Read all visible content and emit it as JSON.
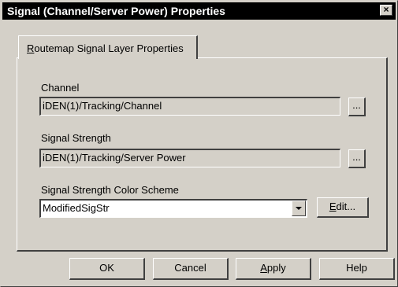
{
  "window": {
    "title": "Signal (Channel/Server Power) Properties",
    "close_label": "×"
  },
  "tab": {
    "accel": "R",
    "label_rest": "outemap Signal Layer Properties"
  },
  "channel": {
    "label": "Channel",
    "value": "iDEN(1)/Tracking/Channel",
    "browse_label": "..."
  },
  "signal_strength": {
    "label": "Signal Strength",
    "value": "iDEN(1)/Tracking/Server Power",
    "browse_label": "..."
  },
  "color_scheme": {
    "label": "Signal Strength Color Scheme",
    "selected": "ModifiedSigStr",
    "edit_accel": "E",
    "edit_rest": "dit..."
  },
  "buttons": {
    "ok": "OK",
    "cancel": "Cancel",
    "apply_accel": "A",
    "apply_rest": "pply",
    "help": "Help"
  }
}
